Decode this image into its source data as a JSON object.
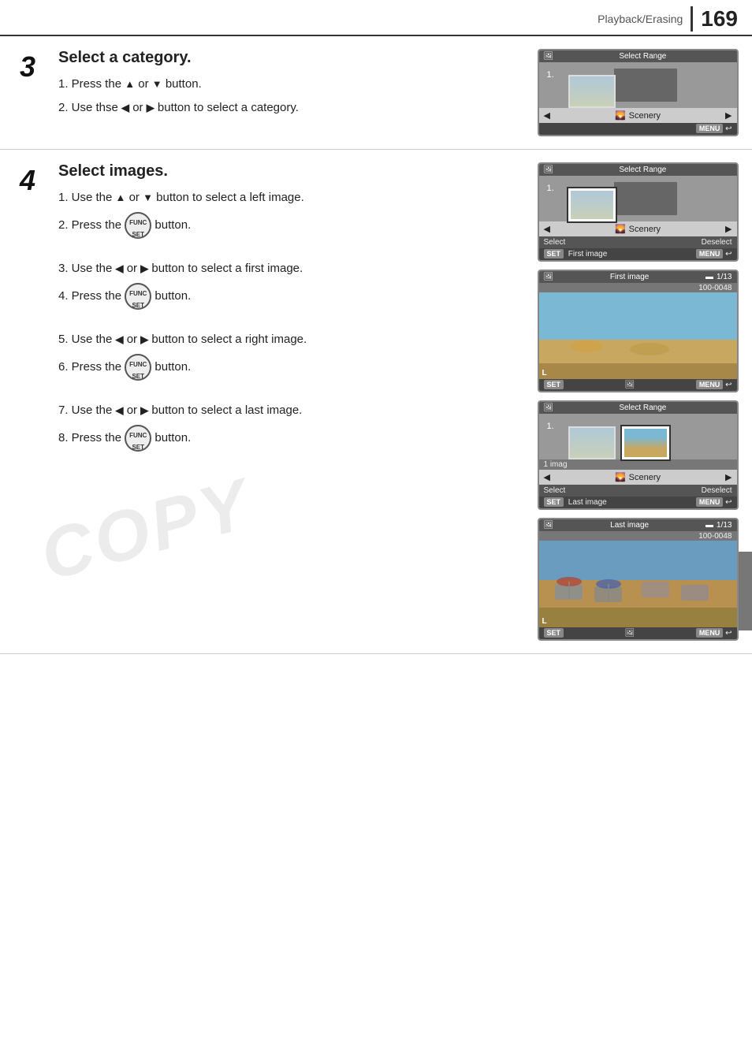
{
  "header": {
    "title": "Playback/Erasing",
    "page": "169"
  },
  "step3": {
    "number": "3",
    "title": "Select a category.",
    "sub1_prefix": "1. Press the",
    "sub1_suffix": "button.",
    "sub1_arrows": "▲ or ▼",
    "sub2_prefix": "2. Use thse",
    "sub2_mid": "or",
    "sub2_suffix": "button to select a category.",
    "sub2_arrows_left": "◀",
    "sub2_arrows_right": "▶"
  },
  "step4": {
    "number": "4",
    "title": "Select images.",
    "sub1_prefix": "1. Use the",
    "sub1_mid": "or",
    "sub1_suffix": "button to select a left image.",
    "sub2": "2. Press the",
    "sub2_suffix": "button.",
    "sub3_prefix": "3. Use the",
    "sub3_mid": "or",
    "sub3_suffix": "button to select a first image.",
    "sub4": "4. Press the",
    "sub4_suffix": "button.",
    "sub5_prefix": "5. Use the",
    "sub5_mid": "or",
    "sub5_suffix": "button to select a right image.",
    "sub6": "6. Press the",
    "sub6_suffix": "button.",
    "sub7_prefix": "7. Use the",
    "sub7_mid": "or",
    "sub7_suffix": "button to select a last image.",
    "sub8": "8. Press the",
    "sub8_suffix": "button."
  },
  "screens": {
    "screen1": {
      "top_label": "Select Range",
      "number": "1.",
      "category": "Scenery",
      "menu": "MENU"
    },
    "screen2": {
      "top_label": "Select Range",
      "number": "1.",
      "category": "Scenery",
      "select": "Select",
      "deselect": "Deselect",
      "set_label": "SET",
      "first_image": "First image",
      "menu": "MENU"
    },
    "screen3": {
      "top_label": "First image",
      "counter": "1/13",
      "file": "100-0048",
      "set_label": "SET",
      "menu": "MENU"
    },
    "screen4": {
      "top_label": "Select Range",
      "number": "1.",
      "img_count": "1 imag",
      "category": "Scenery",
      "select": "Select",
      "deselect": "Deselect",
      "set_label": "SET",
      "last_image": "Last image",
      "menu": "MENU"
    },
    "screen5": {
      "top_label": "Last image",
      "counter": "1/13",
      "file": "100-0048",
      "set_label": "SET",
      "menu": "MENU"
    }
  },
  "watermark": "COPY"
}
